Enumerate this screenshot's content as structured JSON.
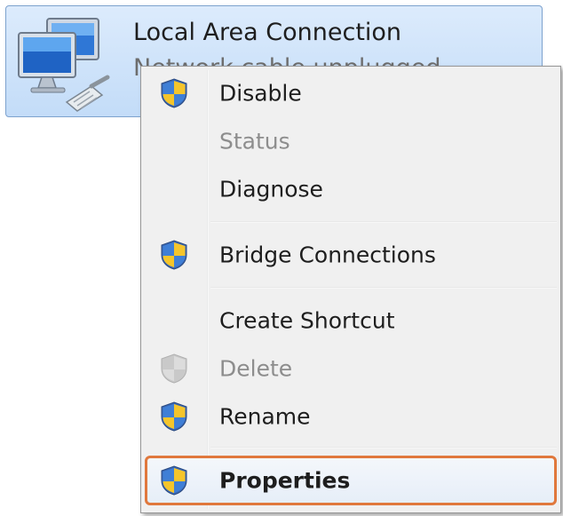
{
  "connection": {
    "name": "Local Area Connection",
    "status": "Network cable unplugged",
    "icon": "network-computer-icon"
  },
  "context_menu": {
    "items": [
      {
        "label": "Disable",
        "icon": "uac-shield-icon",
        "enabled": true
      },
      {
        "label": "Status",
        "icon": null,
        "enabled": false
      },
      {
        "label": "Diagnose",
        "icon": null,
        "enabled": true
      },
      {
        "label": "Bridge Connections",
        "icon": "uac-shield-icon",
        "enabled": true
      },
      {
        "label": "Create Shortcut",
        "icon": null,
        "enabled": true
      },
      {
        "label": "Delete",
        "icon": "uac-shield-icon",
        "enabled": false
      },
      {
        "label": "Rename",
        "icon": "uac-shield-icon",
        "enabled": true
      },
      {
        "label": "Properties",
        "icon": "uac-shield-icon",
        "enabled": true,
        "default": true,
        "highlighted": true
      }
    ]
  },
  "colors": {
    "highlight_border": "#e0783c",
    "selection_tile": "#c3dcf8",
    "disabled_text": "#8d8d8d"
  }
}
